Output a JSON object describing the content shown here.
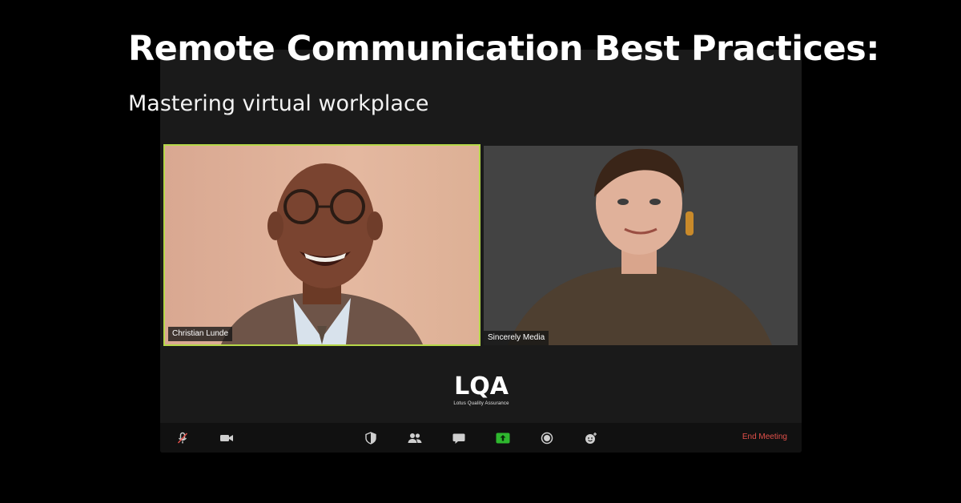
{
  "headline": "Remote Communication Best Practices:",
  "subhead": "Mastering virtual workplace",
  "participants": [
    {
      "name": "Christian Lunde",
      "speaking": true
    },
    {
      "name": "Sincerely Media",
      "speaking": false
    }
  ],
  "logo": {
    "mark": "LQA",
    "tagline": "Lotus Quality Assurance"
  },
  "toolbar": {
    "buttons": [
      {
        "icon": "microphone-muted-icon"
      },
      {
        "icon": "video-camera-icon"
      },
      {
        "icon": "security-shield-icon"
      },
      {
        "icon": "participants-icon"
      },
      {
        "icon": "chat-icon"
      },
      {
        "icon": "share-screen-icon"
      },
      {
        "icon": "record-icon"
      },
      {
        "icon": "reactions-icon"
      }
    ],
    "end_label": "End Meeting"
  },
  "colors": {
    "active_speaker_border": "#b6d749",
    "share_button": "#2eb82e",
    "end_meeting": "#e2504a"
  }
}
